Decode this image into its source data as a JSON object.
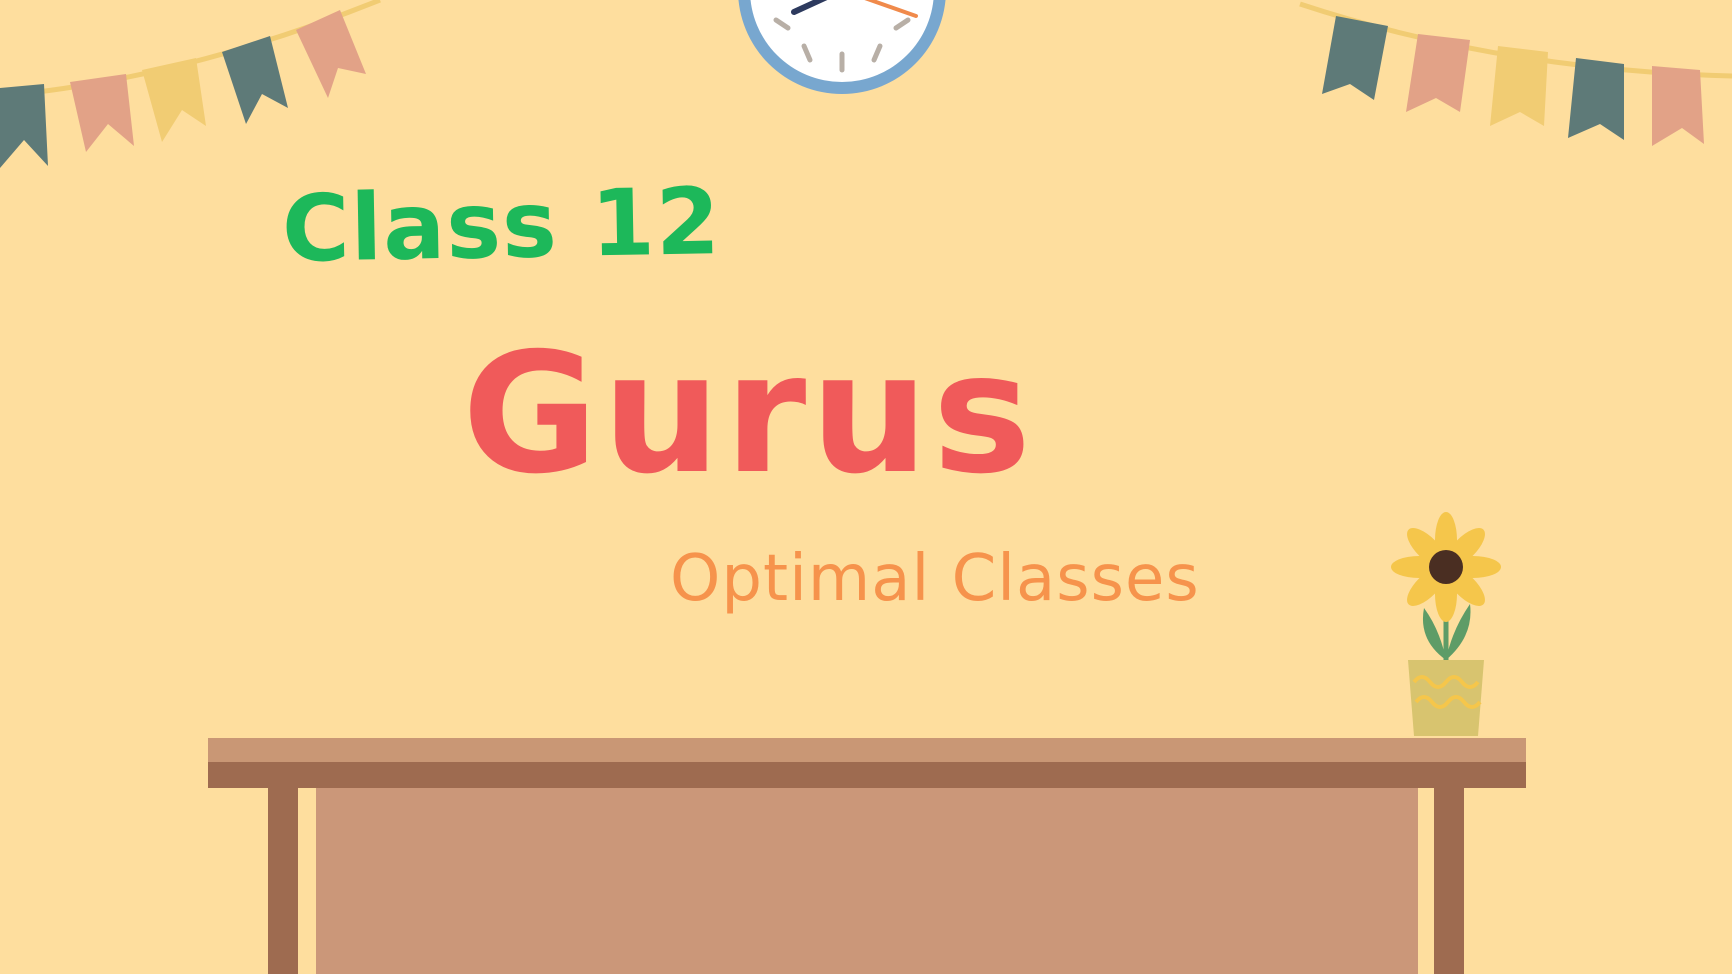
{
  "header": {
    "class_label": "Class 12",
    "brand_name": "Gurus",
    "tagline": "Optimal Classes"
  },
  "colors": {
    "background": "#FEDE9E",
    "class_label": "#1DB85A",
    "brand_name": "#F05A5A",
    "tagline": "#F6934C",
    "bunting": [
      "#5E7A78",
      "#E2A287",
      "#F1CC73"
    ],
    "desk_top": "#A56F53",
    "desk_body": "#CB9779",
    "clock_rim": "#78A7CF"
  },
  "icons": {
    "decor": [
      "bunting-left-icon",
      "bunting-right-icon",
      "wall-clock-icon",
      "sunflower-pot-icon",
      "desk-icon"
    ]
  }
}
